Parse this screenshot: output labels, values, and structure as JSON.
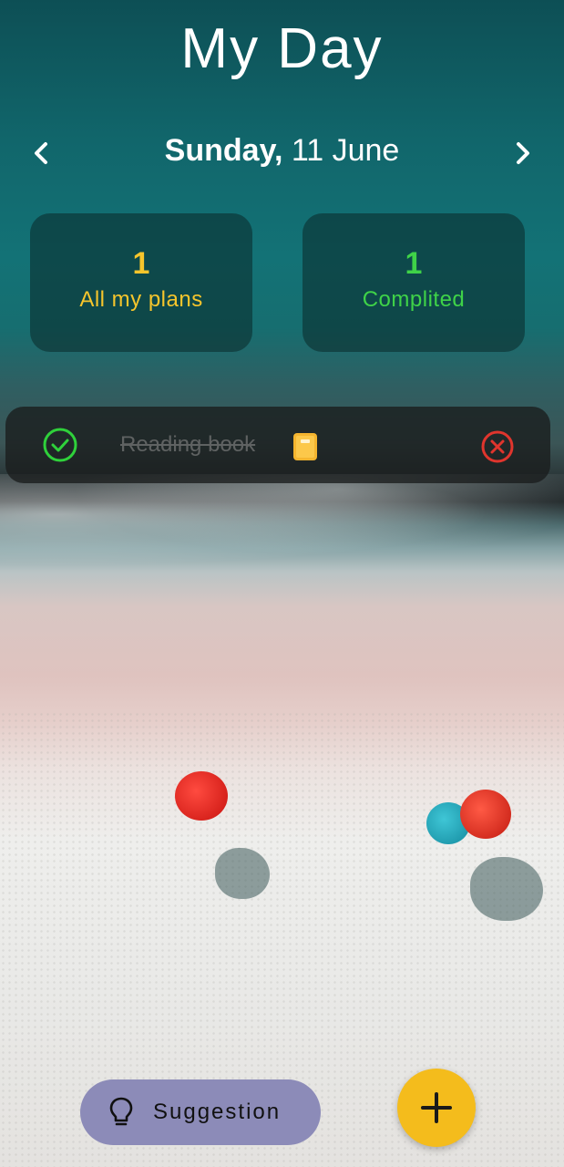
{
  "header": {
    "title": "My Day"
  },
  "date_nav": {
    "prev_icon": "chevron-left-icon",
    "weekday": "Sunday,",
    "date": "11 June",
    "next_icon": "chevron-right-icon"
  },
  "stats": {
    "plans": {
      "count": "1",
      "label": "All my plans",
      "color": "#f6c52c"
    },
    "completed": {
      "count": "1",
      "label": "Complited",
      "color": "#3fd348"
    }
  },
  "tasks": [
    {
      "title": "Reading book",
      "emoji_icon": "book-icon",
      "status": "completed",
      "check_icon": "check-circle-icon",
      "remove_icon": "close-circle-icon"
    }
  ],
  "footer": {
    "suggestion_label": "Suggestion",
    "suggestion_icon": "lightbulb-icon",
    "add_icon": "plus-icon",
    "add_color": "#f4bc1c"
  }
}
